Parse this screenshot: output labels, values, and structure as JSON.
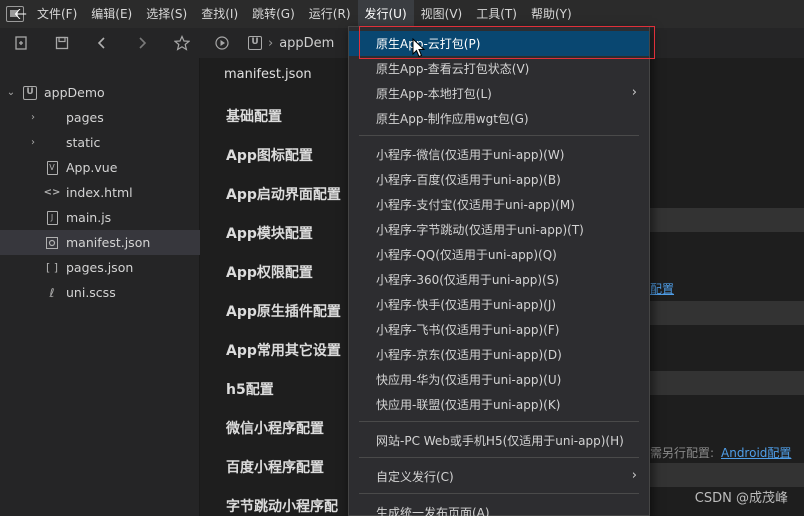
{
  "menubar": {
    "back_glyph": "🡠",
    "items": [
      "文件(F)",
      "编辑(E)",
      "选择(S)",
      "查找(I)",
      "跳转(G)",
      "运行(R)",
      "发行(U)",
      "视图(V)",
      "工具(T)",
      "帮助(Y)"
    ],
    "active": "发行(U)"
  },
  "toolbar": {
    "crumb_project": "appDem"
  },
  "explorer": {
    "project": "appDemo",
    "items": [
      {
        "label": "pages",
        "kind": "folder"
      },
      {
        "label": "static",
        "kind": "folder"
      },
      {
        "label": "App.vue",
        "kind": "vue"
      },
      {
        "label": "index.html",
        "kind": "html"
      },
      {
        "label": "main.js",
        "kind": "js"
      },
      {
        "label": "manifest.json",
        "kind": "json-gear",
        "selected": true
      },
      {
        "label": "pages.json",
        "kind": "json"
      },
      {
        "label": "uni.scss",
        "kind": "scss"
      }
    ]
  },
  "editor": {
    "tab_title": "manifest.json",
    "sections": [
      "基础配置",
      "App图标配置",
      "App启动界面配置",
      "App模块配置",
      "App权限配置",
      "App原生插件配置",
      "App常用其它设置",
      "h5配置",
      "微信小程序配置",
      "百度小程序配置",
      "字节跳动小程序配"
    ],
    "right_link_1": "配置",
    "right_text_2": "需另行配置:",
    "right_link_2": "Android配置",
    "watermark": "CSDN @成茂峰"
  },
  "dropdown": {
    "items": [
      {
        "label": "原生App-云打包(P)",
        "highlight": true
      },
      {
        "label": "原生App-查看云打包状态(V)"
      },
      {
        "label": "原生App-本地打包(L)",
        "submenu": true
      },
      {
        "label": "原生App-制作应用wgt包(G)"
      },
      {
        "sep": true
      },
      {
        "label": "小程序-微信(仅适用于uni-app)(W)"
      },
      {
        "label": "小程序-百度(仅适用于uni-app)(B)"
      },
      {
        "label": "小程序-支付宝(仅适用于uni-app)(M)"
      },
      {
        "label": "小程序-字节跳动(仅适用于uni-app)(T)"
      },
      {
        "label": "小程序-QQ(仅适用于uni-app)(Q)"
      },
      {
        "label": "小程序-360(仅适用于uni-app)(S)"
      },
      {
        "label": "小程序-快手(仅适用于uni-app)(J)"
      },
      {
        "label": "小程序-飞书(仅适用于uni-app)(F)"
      },
      {
        "label": "小程序-京东(仅适用于uni-app)(D)"
      },
      {
        "label": "快应用-华为(仅适用于uni-app)(U)"
      },
      {
        "label": "快应用-联盟(仅适用于uni-app)(K)"
      },
      {
        "sep": true
      },
      {
        "label": "网站-PC Web或手机H5(仅适用于uni-app)(H)"
      },
      {
        "sep": true
      },
      {
        "label": "自定义发行(C)",
        "submenu": true
      },
      {
        "sep": true
      },
      {
        "label": "生成统一发布页面(A)"
      }
    ]
  },
  "colors": {
    "highlight": "#094771",
    "annotation_box": "#e0303a",
    "link": "#4f9ee8"
  }
}
